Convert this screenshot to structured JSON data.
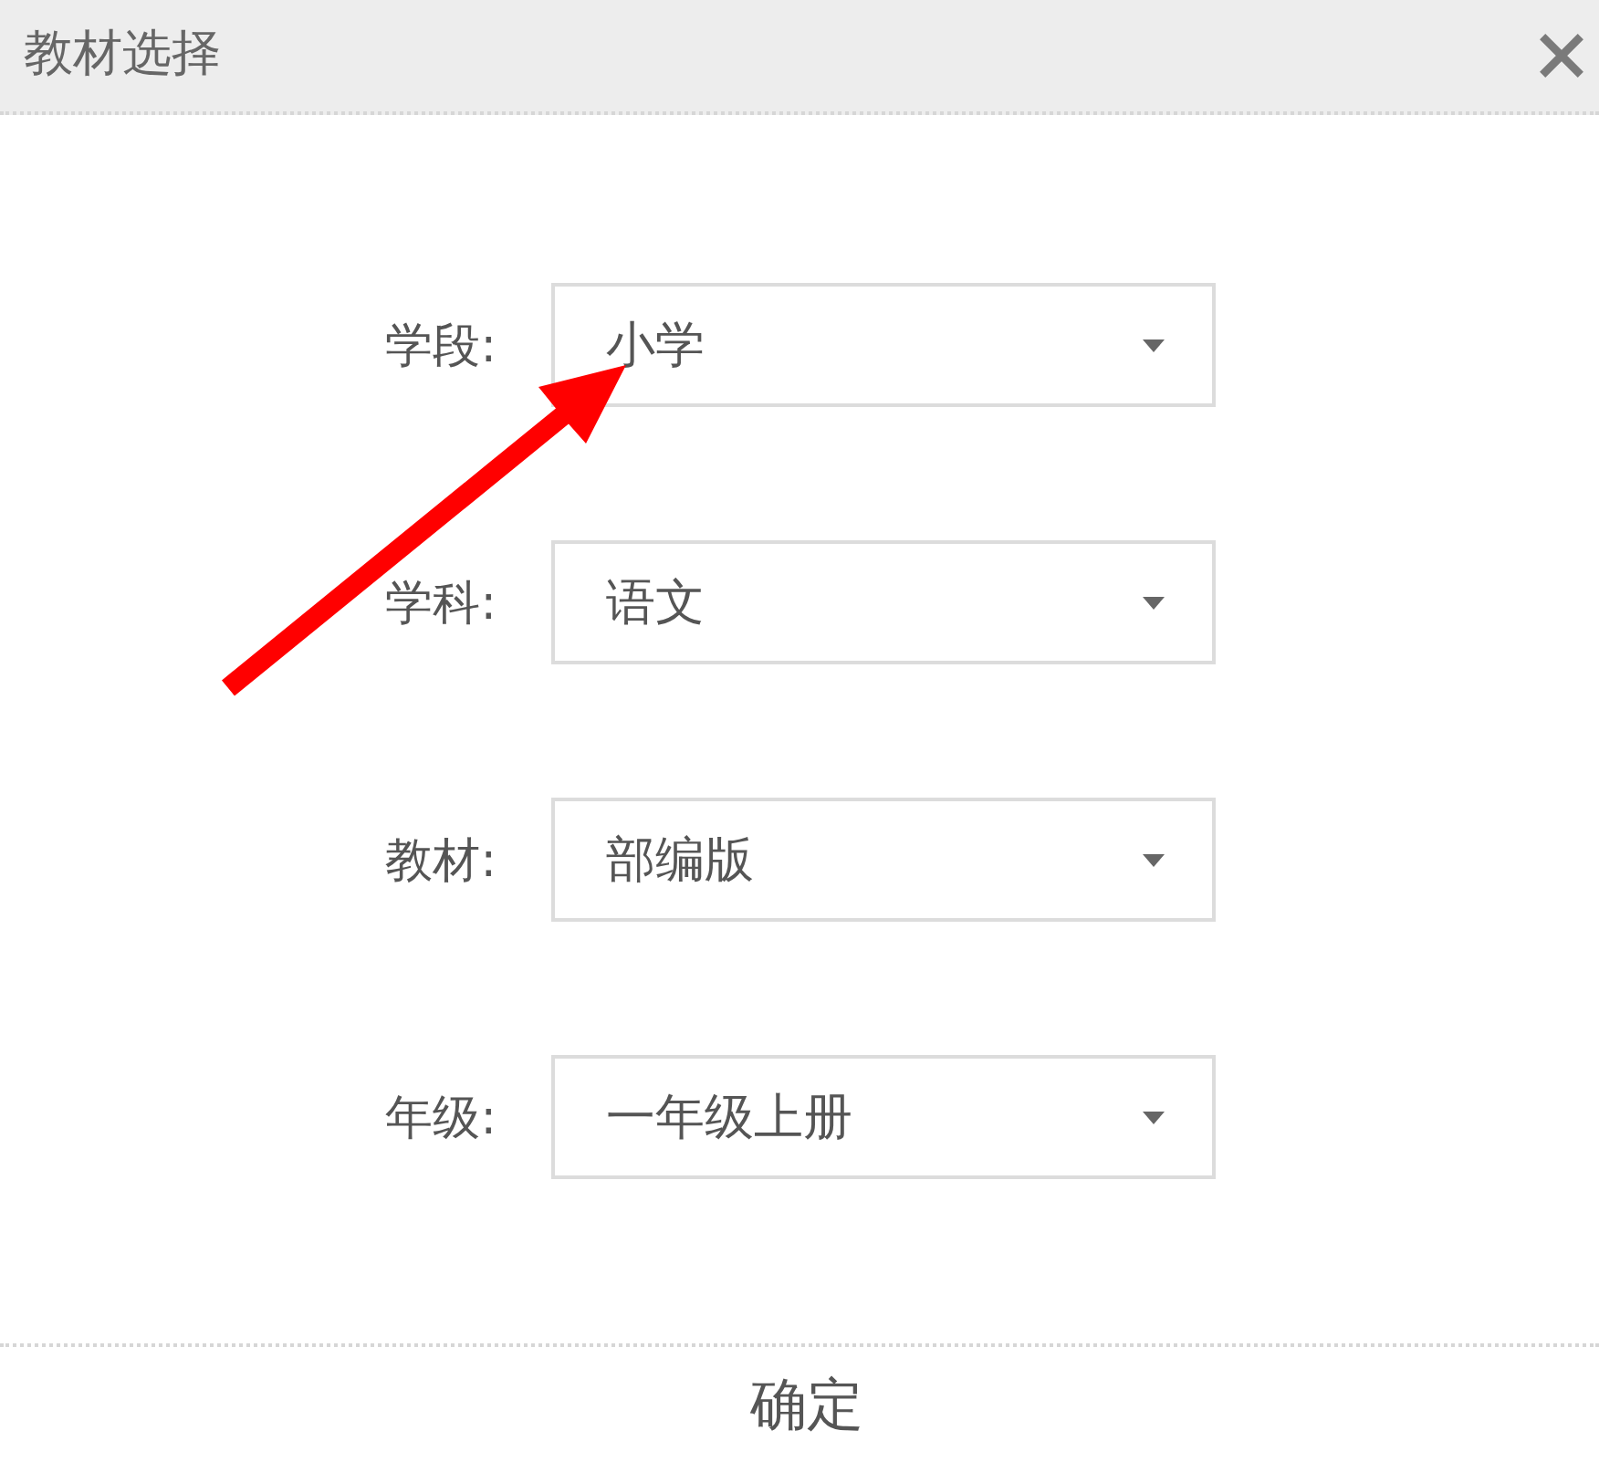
{
  "dialog": {
    "title": "教材选择"
  },
  "fields": [
    {
      "label": "学段:",
      "value": "小学"
    },
    {
      "label": "学科:",
      "value": "语文"
    },
    {
      "label": "教材:",
      "value": "部编版"
    },
    {
      "label": "年级:",
      "value": "一年级上册"
    }
  ],
  "confirm_button": "确定"
}
